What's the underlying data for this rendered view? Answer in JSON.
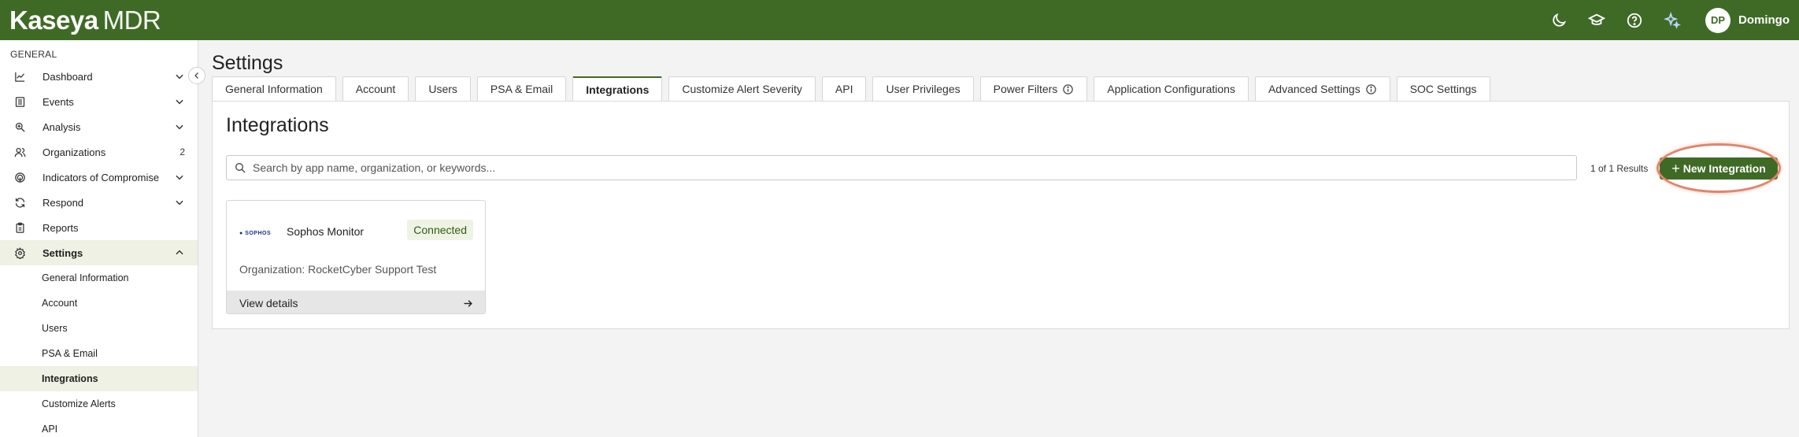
{
  "header": {
    "logo_brand": "Kaseya",
    "logo_product": "MDR",
    "icons": [
      "moon-icon",
      "graduation-cap-icon",
      "help-icon",
      "sparkles-icon"
    ],
    "user_initials": "DP",
    "user_name": "Domingo",
    "bar_color": "#3f6a26"
  },
  "sidebar": {
    "section": "GENERAL",
    "items": [
      {
        "label": "Dashboard",
        "icon": "chart-line-icon",
        "chevron": "down"
      },
      {
        "label": "Events",
        "icon": "list-icon",
        "chevron": "down"
      },
      {
        "label": "Analysis",
        "icon": "magnify-icon",
        "chevron": "down"
      },
      {
        "label": "Organizations",
        "icon": "people-icon",
        "count": "2"
      },
      {
        "label": "Indicators of Compromise",
        "icon": "fingerprint-icon",
        "chevron": "down"
      },
      {
        "label": "Respond",
        "icon": "refresh-icon",
        "chevron": "down"
      },
      {
        "label": "Reports",
        "icon": "clipboard-icon"
      },
      {
        "label": "Settings",
        "icon": "gear-icon",
        "chevron": "up",
        "active": true
      }
    ],
    "sub_items": [
      {
        "label": "General Information"
      },
      {
        "label": "Account"
      },
      {
        "label": "Users"
      },
      {
        "label": "PSA & Email"
      },
      {
        "label": "Integrations",
        "active": true
      },
      {
        "label": "Customize Alerts"
      },
      {
        "label": "API"
      }
    ]
  },
  "page": {
    "title": "Settings",
    "tabs": [
      {
        "label": "General Information"
      },
      {
        "label": "Account"
      },
      {
        "label": "Users"
      },
      {
        "label": "PSA & Email"
      },
      {
        "label": "Integrations",
        "active": true
      },
      {
        "label": "Customize Alert Severity"
      },
      {
        "label": "API"
      },
      {
        "label": "User Privileges"
      },
      {
        "label": "Power Filters",
        "info": true
      },
      {
        "label": "Application Configurations"
      },
      {
        "label": "Advanced Settings",
        "info": true
      },
      {
        "label": "SOC Settings"
      }
    ]
  },
  "integrations": {
    "title": "Integrations",
    "search_placeholder": "Search by app name, organization, or keywords...",
    "search_value": "",
    "results": "1 of 1 Results",
    "new_button": "New Integration",
    "cards": [
      {
        "logo_text": "SOPHOS",
        "name": "Sophos Monitor",
        "status": "Connected",
        "organization": "Organization: RocketCyber Support Test",
        "link": "View details"
      }
    ]
  }
}
